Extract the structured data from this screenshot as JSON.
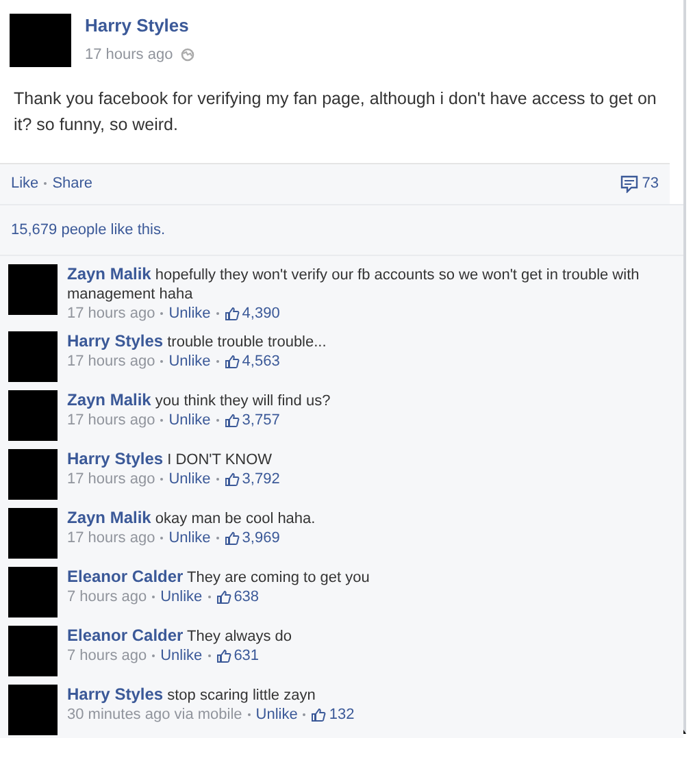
{
  "post": {
    "author": "Harry Styles",
    "time": "17 hours ago",
    "text": "Thank you facebook for verifying my fan page, although i don't have access to get on it? so funny, so weird.",
    "actions": [
      "Like",
      "Share"
    ],
    "comment_count": "73",
    "likes_summary": "15,679 people like this."
  },
  "comments": [
    {
      "author": "Zayn Malik",
      "text": "hopefully they won't verify our fb accounts so we won't get in trouble with management haha",
      "time": "17 hours ago",
      "action": "Unlike",
      "likes": "4,390"
    },
    {
      "author": "Harry Styles",
      "text": "trouble trouble trouble...",
      "time": "17 hours ago",
      "action": "Unlike",
      "likes": "4,563"
    },
    {
      "author": "Zayn Malik",
      "text": "you think they will find us?",
      "time": "17 hours ago",
      "action": "Unlike",
      "likes": "3,757"
    },
    {
      "author": "Harry Styles",
      "text": "I DON'T KNOW",
      "time": "17 hours ago",
      "action": "Unlike",
      "likes": "3,792"
    },
    {
      "author": "Zayn Malik",
      "text": "okay man be cool haha.",
      "time": "17 hours ago",
      "action": "Unlike",
      "likes": "3,969"
    },
    {
      "author": "Eleanor Calder",
      "text": "They are coming to get you",
      "time": "7 hours ago",
      "action": "Unlike",
      "likes": "638"
    },
    {
      "author": "Eleanor Calder",
      "text": "They always do",
      "time": "7 hours ago",
      "action": "Unlike",
      "likes": "631"
    },
    {
      "author": "Harry Styles",
      "text": "stop scaring little zayn",
      "time": "30 minutes ago via mobile",
      "action": "Unlike",
      "likes": "132"
    }
  ]
}
